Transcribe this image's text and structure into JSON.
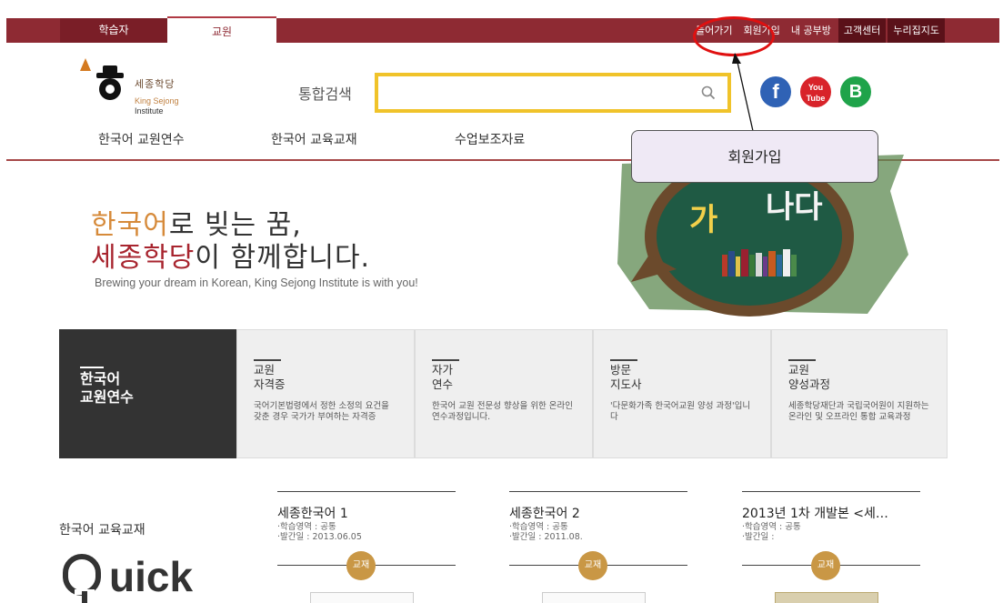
{
  "top_bar": {
    "tabs": [
      {
        "label": "학습자",
        "active": false
      },
      {
        "label": "교원",
        "active": true
      }
    ],
    "utility_links": [
      {
        "label": "들어가기"
      },
      {
        "label": "회원가입"
      },
      {
        "label": "내 공부방"
      },
      {
        "label": "고객센터"
      },
      {
        "label": "누리집지도"
      }
    ]
  },
  "logo": {
    "ko": "세종학당",
    "en_line1": "King Sejong",
    "en_line2": "Institute"
  },
  "search": {
    "label": "통합검색",
    "value": "",
    "placeholder": ""
  },
  "social": {
    "facebook_glyph": "f",
    "youtube_line1": "You",
    "youtube_line2": "Tube",
    "blog_glyph": "B"
  },
  "main_nav": [
    {
      "label": "한국어 교원연수"
    },
    {
      "label": "한국어 교육교재"
    },
    {
      "label": "수업보조자료"
    }
  ],
  "callout": {
    "label": "회원가입"
  },
  "hero": {
    "line1_highlight": "한국어",
    "line1_rest": "로 빚는 꿈,",
    "line2_highlight": "세종학당",
    "line2_rest": "이 함께합니다.",
    "subtitle": "Brewing your dream in Korean, King Sejong Institute is with you!",
    "board_char1": "가",
    "board_char2": "나다"
  },
  "courses": {
    "lead_title": "한국어\n교원연수",
    "cards": [
      {
        "title": "교원\n자격증",
        "desc": "국어기본법령에서 정한 소정의 요건을 갖춘 경우 국가가 부여하는 자격증"
      },
      {
        "title": "자가\n연수",
        "desc": "한국어 교원 전문성 향상을 위한 온라인 연수과정입니다."
      },
      {
        "title": "방문\n지도사",
        "desc": "'다문화가족 한국어교원 양성 과정'입니다"
      },
      {
        "title": "교원\n양성과정",
        "desc": "세종학당재단과 국립국어원이 지원하는 온라인 및 오프라인 통합 교육과정"
      }
    ]
  },
  "textbooks": {
    "heading": "한국어 교육교재",
    "quick_logo": "uick",
    "items": [
      {
        "title": "세종한국어 1",
        "meta1": "·학습영역 : 공통",
        "meta2": "·발간일 : 2013.06.05",
        "badge": "교재"
      },
      {
        "title": "세종한국어 2",
        "meta1": "·학습영역 : 공통",
        "meta2": "·발간일 : 2011.08.",
        "badge": "교재"
      },
      {
        "title": "2013년 1차 개발본 <세…",
        "meta1": "·학습영역 : 공통",
        "meta2": "·발간일 :",
        "badge": "교재"
      }
    ]
  },
  "colors": {
    "brand_maroon": "#8e2a33",
    "search_border": "#f0c32a",
    "highlight_orange": "#d68a3a",
    "highlight_red": "#a8252f",
    "callout_red": "#e01010",
    "badge_gold": "#c99745"
  }
}
